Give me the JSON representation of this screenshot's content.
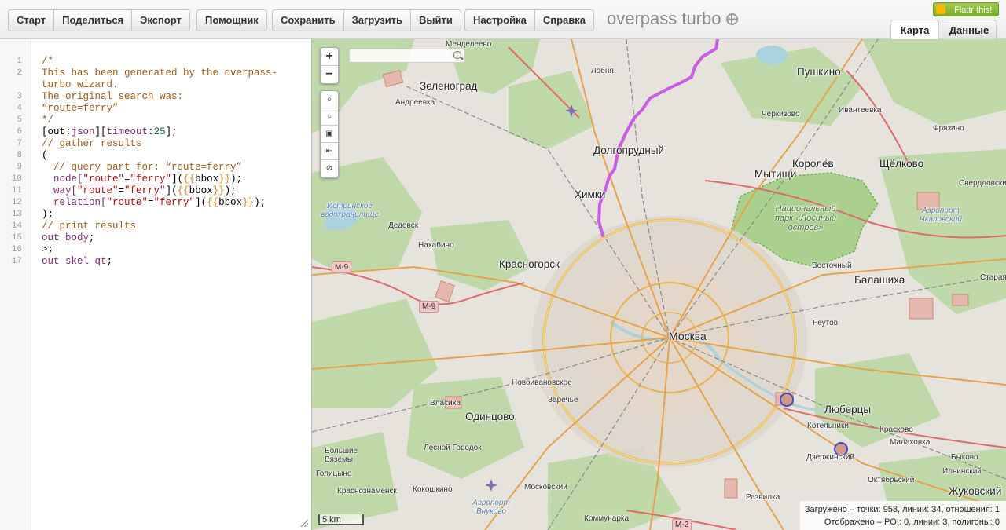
{
  "toolbar": {
    "group1": [
      "Старт",
      "Поделиться",
      "Экспорт"
    ],
    "group2": [
      "Помощник"
    ],
    "group3": [
      "Сохранить",
      "Загрузить",
      "Выйти"
    ],
    "group4": [
      "Настройка",
      "Справка"
    ],
    "logo_text": "overpass turbo",
    "flattr_label": "Flattr this!",
    "tabs": {
      "map": "Карта",
      "data": "Данные"
    }
  },
  "editor": {
    "line_numbers": [
      "1",
      "2",
      "",
      "3",
      "4",
      "5",
      "6",
      "7",
      "8",
      "9",
      "10",
      "11",
      "12",
      "13",
      "14",
      "15",
      "16",
      "17"
    ],
    "lines": [
      [
        {
          "t": "/*",
          "c": "cm"
        }
      ],
      [
        {
          "t": "This has been generated by the overpass-",
          "c": "cm"
        }
      ],
      [
        {
          "t": "turbo wizard.",
          "c": "cm"
        }
      ],
      [
        {
          "t": "The original search was:",
          "c": "cm"
        }
      ],
      [
        {
          "t": "“route=ferry”",
          "c": "cm"
        }
      ],
      [
        {
          "t": "*/",
          "c": "cm"
        }
      ],
      [
        {
          "t": "[out:",
          "c": "pl"
        },
        {
          "t": "json",
          "c": "kw"
        },
        {
          "t": "][",
          "c": "pl"
        },
        {
          "t": "timeout",
          "c": "kw"
        },
        {
          "t": ":",
          "c": "pl"
        },
        {
          "t": "25",
          "c": "nb"
        },
        {
          "t": "];",
          "c": "pl"
        }
      ],
      [
        {
          "t": "// gather results",
          "c": "cm"
        }
      ],
      [
        {
          "t": "(",
          "c": "pl"
        }
      ],
      [
        {
          "t": "  // query part for: “route=ferry”",
          "c": "cm"
        }
      ],
      [
        {
          "t": "  node[",
          "c": "kw"
        },
        {
          "t": "\"route\"",
          "c": "st"
        },
        {
          "t": "=",
          "c": "pl"
        },
        {
          "t": "\"ferry\"",
          "c": "st"
        },
        {
          "t": "](",
          "c": "pl"
        },
        {
          "t": "{{",
          "c": "br"
        },
        {
          "t": "bbox",
          "c": "pl"
        },
        {
          "t": "}}",
          "c": "br"
        },
        {
          "t": ");",
          "c": "pl"
        }
      ],
      [
        {
          "t": "  way[",
          "c": "kw"
        },
        {
          "t": "\"route\"",
          "c": "st"
        },
        {
          "t": "=",
          "c": "pl"
        },
        {
          "t": "\"ferry\"",
          "c": "st"
        },
        {
          "t": "](",
          "c": "pl"
        },
        {
          "t": "{{",
          "c": "br"
        },
        {
          "t": "bbox",
          "c": "pl"
        },
        {
          "t": "}}",
          "c": "br"
        },
        {
          "t": ");",
          "c": "pl"
        }
      ],
      [
        {
          "t": "  relation[",
          "c": "kw"
        },
        {
          "t": "\"route\"",
          "c": "st"
        },
        {
          "t": "=",
          "c": "pl"
        },
        {
          "t": "\"ferry\"",
          "c": "st"
        },
        {
          "t": "](",
          "c": "pl"
        },
        {
          "t": "{{",
          "c": "br"
        },
        {
          "t": "bbox",
          "c": "pl"
        },
        {
          "t": "}}",
          "c": "br"
        },
        {
          "t": ");",
          "c": "pl"
        }
      ],
      [
        {
          "t": ");",
          "c": "pl"
        }
      ],
      [
        {
          "t": "// print results",
          "c": "cm"
        }
      ],
      [
        {
          "t": "out body",
          "c": "kw"
        },
        {
          "t": ";",
          "c": "pl"
        }
      ],
      [
        {
          "t": ">;",
          "c": "pl"
        }
      ],
      [
        {
          "t": "out skel qt",
          "c": "kw"
        },
        {
          "t": ";",
          "c": "pl"
        }
      ]
    ]
  },
  "map": {
    "search_placeholder": "",
    "zoom_in": "+",
    "zoom_out": "−",
    "scale_label": "5 km",
    "status_loaded": "Загружено – точки: 958, линии: 34, отношения: 1",
    "status_displayed": "Отображено – POI: 0, линии: 3, полигоны: 0",
    "labels": {
      "mendeleevo": "Менделеево",
      "lobnya": "Лобня",
      "pushkino": "Пушкино",
      "zelenograd": "Зеленоград",
      "andreevka": "Андреевка",
      "cherkizovo": "Черкизово",
      "ivanteevka": "Ивантеевка",
      "fryazino": "Фрязино",
      "dolgoprudny": "Долгопрудный",
      "mytishchi": "Мытищи",
      "korolev": "Королёв",
      "shchelkovo": "Щёлково",
      "sverdlovsky": "Свердловский",
      "khimki": "Химки",
      "istra_reservoir": "Истринское водохранилище",
      "national_park": "Национальный парк «Лосиный остров»",
      "airport_chkalovsky": "Аэропорт Чкаловский",
      "dedovsk": "Дедовск",
      "nakhabino": "Нахабино",
      "krasnogorsk": "Красногорск",
      "vostochny": "Восточный",
      "balashikha": "Балашиха",
      "staraya": "Старая",
      "reutov": "Реутов",
      "moskva": "Москва",
      "novoivanovskoe": "Новоивановское",
      "zarechye": "Заречье",
      "vlasikha": "Власиха",
      "odintsovo": "Одинцово",
      "lyubertsy": "Люберцы",
      "kotelniki": "Котельники",
      "kraskovo": "Красково",
      "malakhovka": "Малаховка",
      "lesnoy_gorodok": "Лесной Городок",
      "dzerzhinsky": "Дзержинский",
      "bykovo": "Быково",
      "bolshie_vyazemy": "Большие Вяземы",
      "ilyinsky": "Ильинский",
      "oktyabrsky": "Октябрьский",
      "krasnoznamensk": "Краснознаменск",
      "kokoshkino": "Кокошкино",
      "moskovsky": "Московский",
      "airport_vnukovo": "Аэропорт Внуково",
      "razvilka": "Развилка",
      "zhukovsky": "Жуковский",
      "kommunarka": "Коммунарка",
      "golitsyno": "Голицыно",
      "m9_a": "М-9",
      "m9_b": "М-9",
      "m2": "М-2"
    }
  }
}
